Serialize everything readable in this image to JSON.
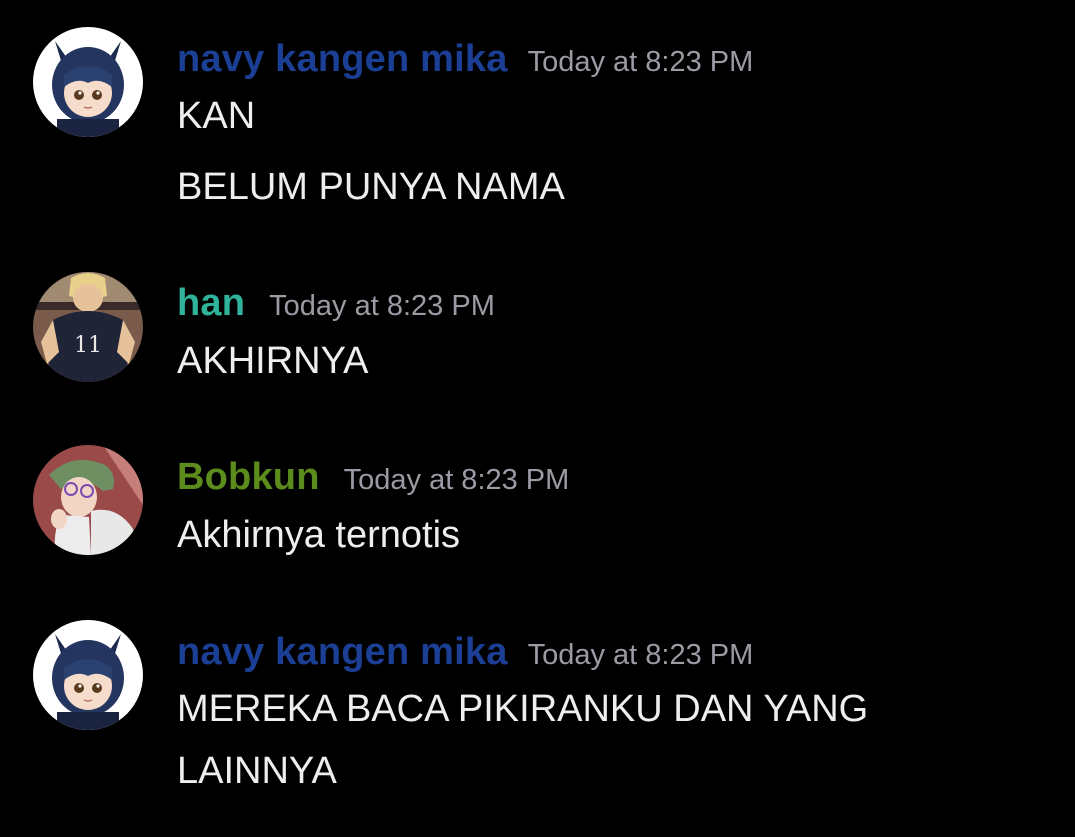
{
  "colors": {
    "background": "#000000",
    "message_text": "#eeeef0",
    "timestamp": "#9a9ba3",
    "navy": "#1b3f95",
    "han": "#2fb39a",
    "bobkun": "#5c8c1c"
  },
  "messages": [
    {
      "username": "navy kangen mika",
      "timestamp": "Today at 8:23 PM",
      "avatar_icon": "anime-girl-cat-ears-avatar",
      "lines": [
        "KAN",
        "BELUM PUNYA NAMA"
      ]
    },
    {
      "username": "han",
      "timestamp": "Today at 8:23 PM",
      "avatar_icon": "volleyball-player-11-avatar",
      "jersey_number": "11",
      "lines": [
        "AKHIRNYA"
      ]
    },
    {
      "username": "Bobkun",
      "timestamp": "Today at 8:23 PM",
      "avatar_icon": "green-hair-glasses-avatar",
      "lines": [
        "Akhirnya ternotis"
      ]
    },
    {
      "username": "navy kangen mika",
      "timestamp": "Today at 8:23 PM",
      "avatar_icon": "anime-girl-cat-ears-avatar",
      "lines": [
        "MEREKA BACA PIKIRANKU DAN YANG",
        "LAINNYA"
      ]
    }
  ]
}
